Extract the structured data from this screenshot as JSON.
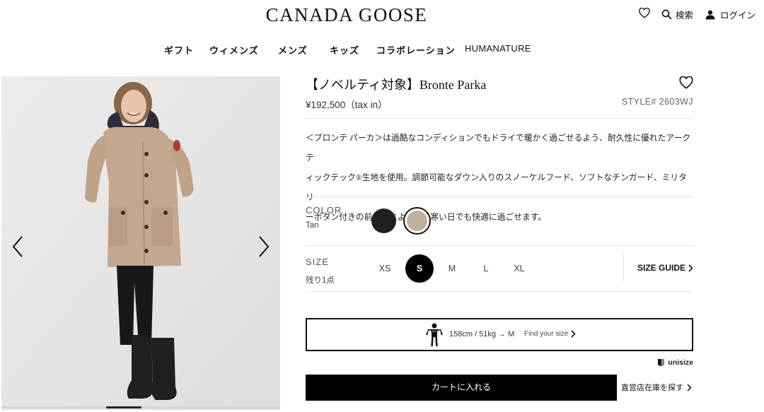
{
  "header": {
    "logo": "CANADA GOOSE",
    "search_label": "検索",
    "login_label": "ログイン"
  },
  "nav": [
    "ギフト",
    "ウィメンズ",
    "メンズ",
    "キッズ",
    "コラボレーション",
    "HUMANATURE"
  ],
  "product": {
    "title": "【ノベルティ対象】Bronte Parka",
    "price": "¥192,500（tax in）",
    "style": "STYLE# 2603WJ",
    "description": [
      "＜ブロンテ パーカ＞は過酷なコンディションでもドライで暖かく過ごせるよう、耐久性に優れたアークテ",
      "ィックテック®生地を使用。調節可能なダウン入りのスノーケルフード、ソフトなチンガード、ミリタリ",
      "ーボタン付きの前立てにより、肌寒い日でも快適に過ごせます。"
    ]
  },
  "color": {
    "label": "COLOR",
    "selected": "Tan",
    "swatches": [
      {
        "name": "Black",
        "hex": "#1f2024",
        "selected": false
      },
      {
        "name": "Tan",
        "hex": "#bdb39b",
        "selected": true
      }
    ]
  },
  "size": {
    "label": "SIZE",
    "stock_note": "残り1点",
    "options": [
      {
        "label": "XS",
        "selected": false
      },
      {
        "label": "S",
        "selected": true
      },
      {
        "label": "M",
        "selected": false
      },
      {
        "label": "L",
        "selected": false
      },
      {
        "label": "XL",
        "selected": false
      }
    ],
    "guide_label": "SIZE GUIDE"
  },
  "unisize": {
    "measurement": "158cm / 51kg → M",
    "find_label": "Find your size",
    "brand": "unisize"
  },
  "actions": {
    "cart_label": "カートに入れる",
    "store_label": "直営店在庫を探す"
  },
  "colors": {
    "accent": "#000000",
    "gallery_bg": "#e6e6e6",
    "coat": "#c4a78e"
  }
}
